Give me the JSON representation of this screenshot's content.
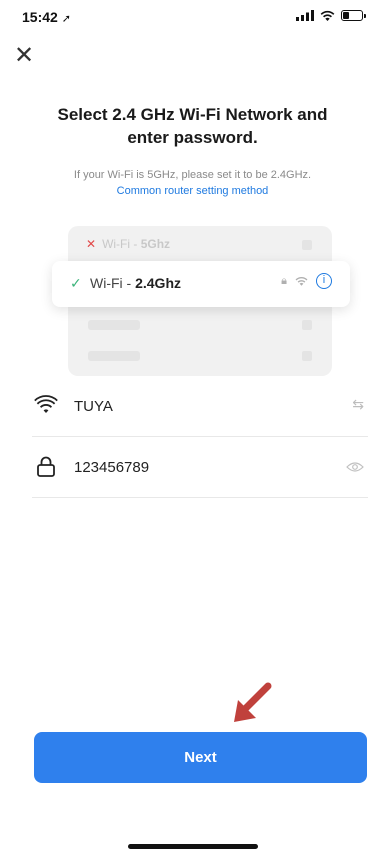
{
  "status_bar": {
    "time": "15:42"
  },
  "header": {
    "close_glyph": "✕"
  },
  "title_line1": "Select 2.4 GHz Wi-Fi Network and",
  "title_line2": "enter password.",
  "subtitle": "If your Wi-Fi is 5GHz, please set it to be 2.4GHz.",
  "help_link": "Common router setting method",
  "illustration": {
    "bad_network": {
      "prefix": "Wi-Fi - ",
      "band": "5Ghz"
    },
    "good_network": {
      "prefix": "Wi-Fi - ",
      "band": "2.4Ghz"
    }
  },
  "wifi_field": {
    "value": "TUYA",
    "icon": "wifi-icon",
    "action_icon": "switch-arrows-icon"
  },
  "password_field": {
    "value": "123456789",
    "icon": "lock-icon",
    "action_icon": "eye-icon"
  },
  "next_button": {
    "label": "Next",
    "color": "#2f80ed"
  },
  "annotation": {
    "arrow_color": "#c0413c"
  }
}
